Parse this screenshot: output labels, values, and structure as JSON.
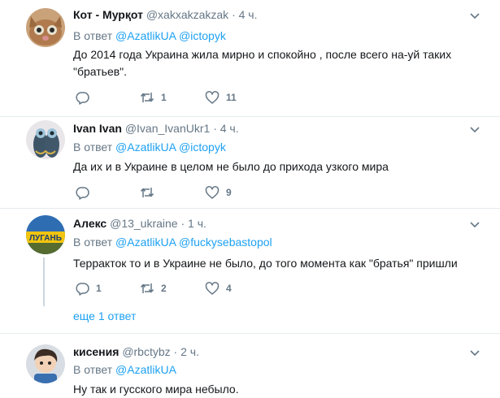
{
  "tweets": [
    {
      "name": "Кот - Мурқот",
      "handle": "@xakxakzakzak",
      "time": "· 4 ч.",
      "reply_label": "В ответ",
      "mentions": [
        "@AzatlikUA",
        "@ictopyk"
      ],
      "text_lines": [
        "До 2014 года Украина жила мирно и спокойно , после всего на-уй таких",
        "\"братьев\"."
      ],
      "replies": "",
      "retweets": "1",
      "likes": "11"
    },
    {
      "name": "Ivan Ivan",
      "handle": "@Ivan_IvanUkr1",
      "time": "· 4 ч.",
      "reply_label": "В ответ",
      "mentions": [
        "@AzatlikUA",
        "@ictopyk"
      ],
      "text_lines": [
        "Да их и в Украине в целом не было до прихода узкого мира"
      ],
      "replies": "",
      "retweets": "",
      "likes": "9"
    },
    {
      "name": "Алекс",
      "handle": "@13_ukraine",
      "time": "· 1 ч.",
      "reply_label": "В ответ",
      "mentions": [
        "@AzatlikUA",
        "@fuckysebastopol"
      ],
      "text_lines": [
        "Терракток то и в Украине не было, до того момента как \"братья\" пришли"
      ],
      "replies": "1",
      "retweets": "2",
      "likes": "4",
      "avatar_text": "ЛУГАНЬ"
    },
    {
      "name": "кисения",
      "handle": "@rbctybz",
      "time": "· 2 ч.",
      "reply_label": "В ответ",
      "mentions": [
        "@AzatlikUA"
      ],
      "text_lines": [
        "Ну так и гусского мира небыло."
      ]
    }
  ],
  "more_replies": "еще 1 ответ",
  "colors": {
    "accent": "#1da1f2",
    "muted": "#657786",
    "separator": "#e6ecf0",
    "thread_line": "#ccd6dd"
  },
  "icons": [
    "reply-icon",
    "retweet-icon",
    "like-icon",
    "chevron-down-icon"
  ]
}
